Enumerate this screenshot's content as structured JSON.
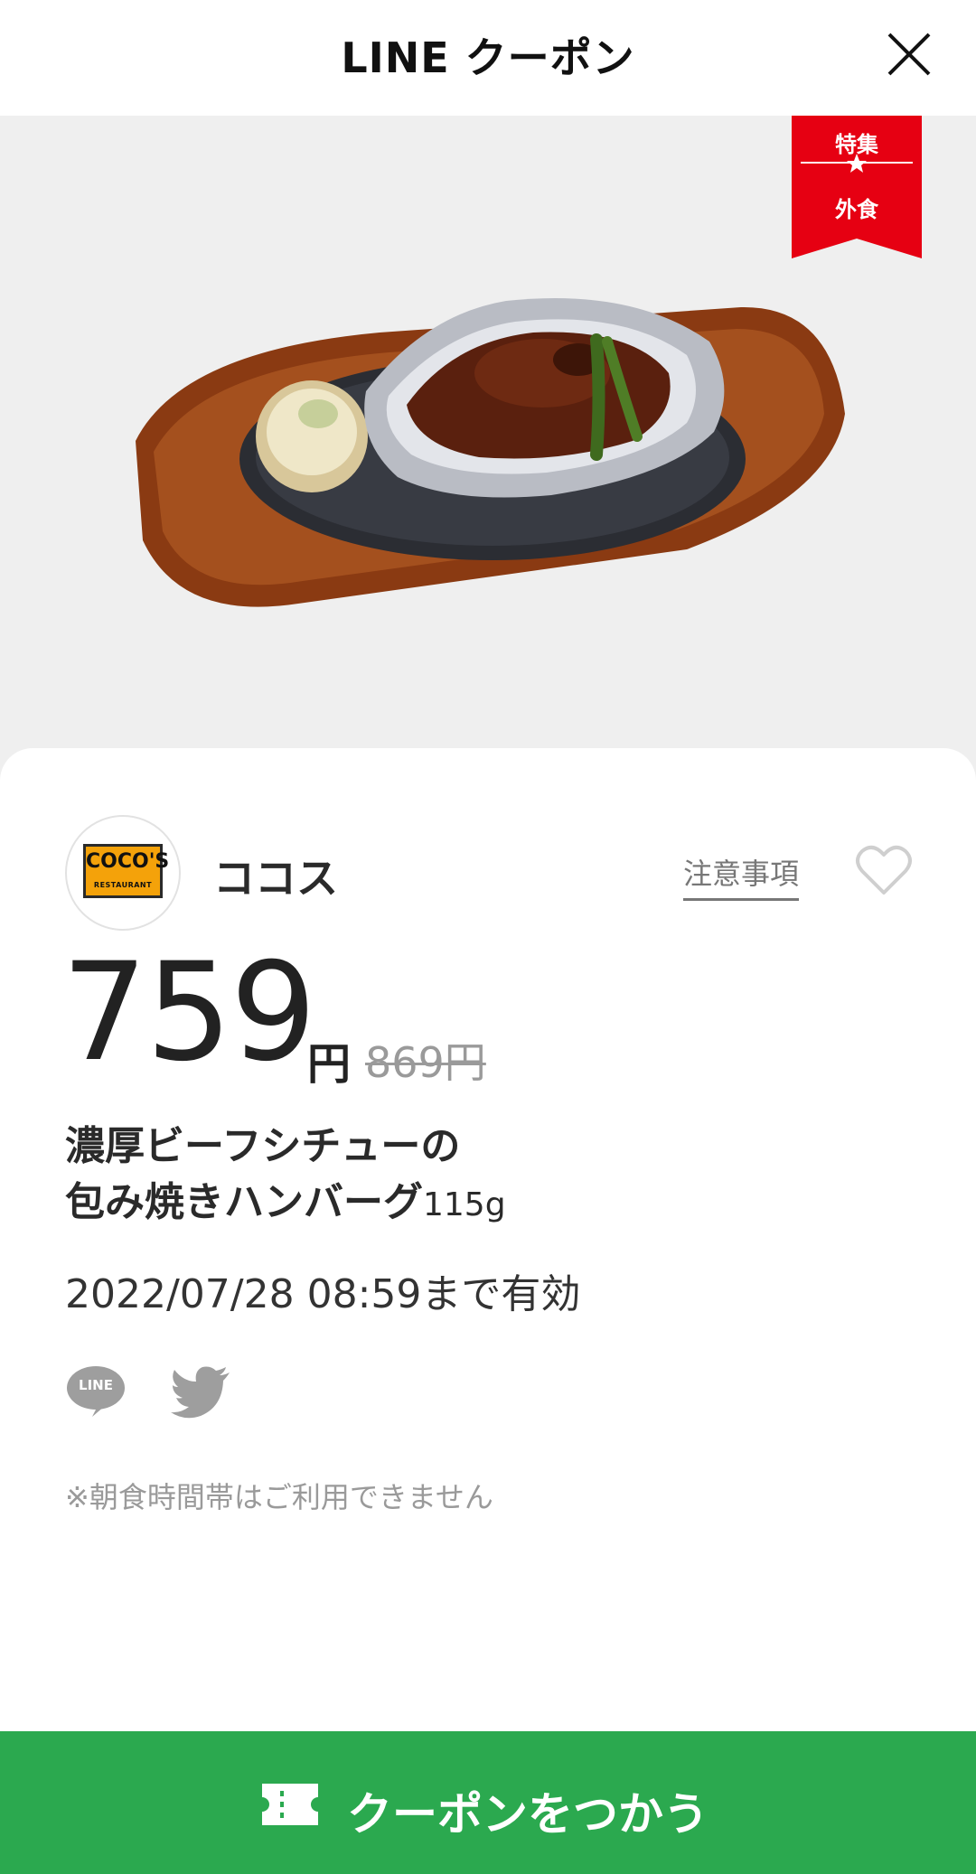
{
  "header": {
    "title": "LINE クーポン",
    "close_icon": "close-icon"
  },
  "hero": {
    "ribbon_line1": "特集",
    "ribbon_line2": "外食",
    "ribbon_color": "#e60012"
  },
  "store": {
    "logo_brand": "COCO'S",
    "logo_sub": "RESTAURANT",
    "name": "ココス",
    "notes_label": "注意事項"
  },
  "coupon": {
    "price": "759",
    "price_unit": "円",
    "original_price": "869円",
    "title_line1": "濃厚ビーフシチューの",
    "title_line2": "包み焼きハンバーグ",
    "title_weight": "115g",
    "validity": "2022/07/28  08:59まで有効",
    "note": "※朝食時間帯はご利用できません"
  },
  "share": {
    "line_label": "LINE",
    "icons": [
      "line-icon",
      "twitter-icon"
    ]
  },
  "action": {
    "use_label": "クーポンをつかう",
    "color": "#2ba94f"
  }
}
